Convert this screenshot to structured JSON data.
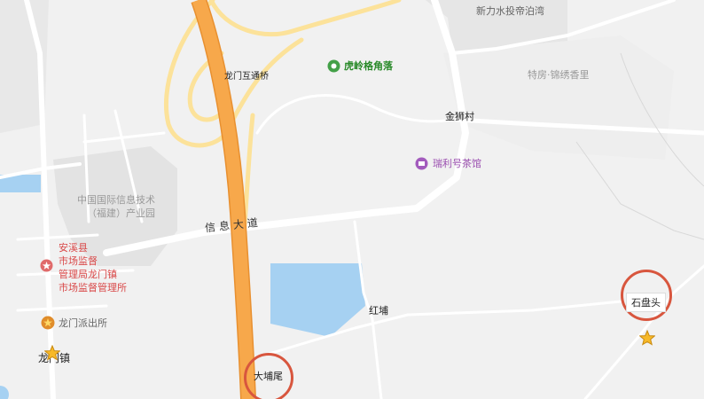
{
  "labels": {
    "xinlishui": "新力水投帝泊湾",
    "hulingge": "虎岭格角落",
    "longmen_interchange": "龙门互通桥",
    "jinshicun": "金狮村",
    "tefang": "特房·锦绣香里",
    "ruili": "瑞利号茶馆",
    "info_park_line1": "中国国际信息技术",
    "info_park_line2": "（福建）产业园",
    "xinxi_road": "信息大道",
    "anxi_line1": "安溪县",
    "anxi_line2": "市场监督",
    "anxi_line3": "管理局龙门镇",
    "anxi_line4": "市场监督管理所",
    "police": "龙门派出所",
    "longmen_town": "龙门镇",
    "hongpu": "红埔",
    "dapuwei": "大埔尾",
    "shipantou": "石盘头"
  },
  "colors": {
    "background": "#f1f1f1",
    "expressway": "#f7a84b",
    "ramp": "#fce29a",
    "road": "#ffffff",
    "water": "#a6d1f2",
    "marker": "#d8563e",
    "green_poi": "#2a8a2a",
    "purple_poi": "#9b4fb0",
    "red_poi": "#d94848"
  },
  "icons": {
    "hulingge": "green-circle-poi-icon",
    "ruili": "purple-circle-poi-icon",
    "anxi": "red-star-poi-icon",
    "police": "orange-police-star-icon",
    "longmen_town": "yellow-star-town-icon",
    "shipantou": "yellow-star-marker-icon"
  }
}
